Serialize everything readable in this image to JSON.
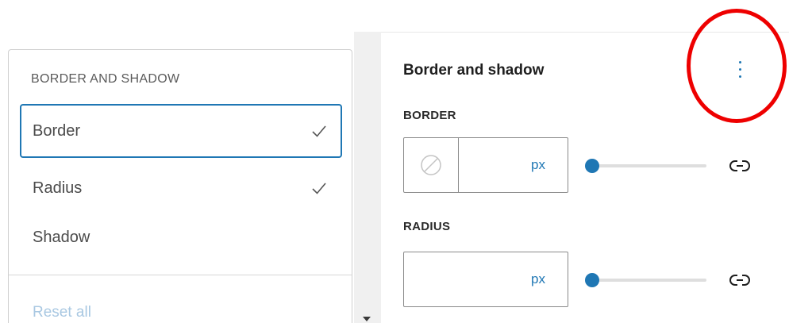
{
  "dropdown": {
    "heading": "BORDER AND SHADOW",
    "items": [
      {
        "label": "Border",
        "checked": true,
        "focused": true
      },
      {
        "label": "Radius",
        "checked": true,
        "focused": false
      },
      {
        "label": "Shadow",
        "checked": false,
        "focused": false
      }
    ],
    "reset_label": "Reset all"
  },
  "panel": {
    "title": "Border and shadow",
    "border": {
      "label": "BORDER",
      "value": "",
      "unit": "px",
      "slider_value": 0
    },
    "radius": {
      "label": "RADIUS",
      "value": "",
      "unit": "px",
      "slider_value": 0
    }
  },
  "colors": {
    "accent": "#1f77b4",
    "highlight_circle": "#ee0000",
    "reset_disabled": "#a9c8e2"
  },
  "icons": {
    "options": "vertical-ellipsis-icon",
    "check": "checkmark-icon",
    "swatch": "no-color-swatch-icon",
    "link": "link-unlinked-icon"
  }
}
